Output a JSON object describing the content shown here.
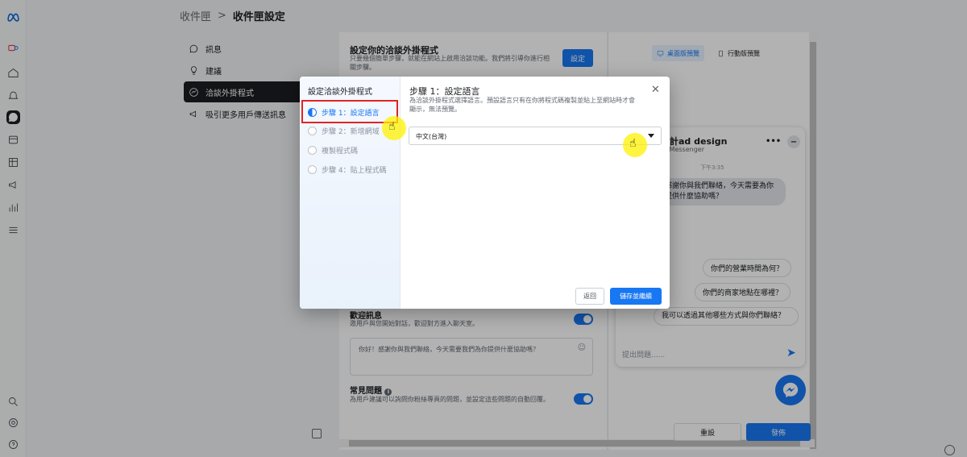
{
  "breadcrumb": {
    "parent": "收件匣",
    "separator": ">",
    "current": "收件匣設定"
  },
  "subnav": [
    {
      "label": "訊息",
      "icon": "chat-icon"
    },
    {
      "label": "建議",
      "icon": "lightbulb-icon"
    },
    {
      "label": "洽談外掛程式",
      "icon": "messenger-icon"
    },
    {
      "label": "吸引更多用戶傳送訊息",
      "icon": "megaphone-icon"
    }
  ],
  "main": {
    "heading": "設定你的洽談外掛程式",
    "description": "只要幾個簡單步驟，就能在網站上啟用洽談功能。我們將引導你進行相關步驟。",
    "set_label": "設定",
    "greeting_title": "歡迎訊息",
    "greeting_desc": "邀用戶與您開始對話，歡迎對方進入聊天室。",
    "greeting_text": "你好！感謝你與我們聯絡，今天需要我們為你提供什麼協助嗎？",
    "faq_title": "常見問題",
    "faq_desc": "為用戶建議可以詢問你粉絲專頁的問題，並設定這些問題的自動回覆。"
  },
  "preview": {
    "desktop_tab": "桌面版預覽",
    "mobile_tab": "行動版預覽",
    "chat_name": "設計ad design",
    "chat_via": "… Messenger",
    "time": "下午3:35",
    "incoming": "感謝你與我們聯絡，今天需要為你提供什麼協助嗎？",
    "quick_replies": [
      "你們的營業時間為何？",
      "你們的商家地點在哪裡？",
      "我可以透過其他哪些方式與你們聯絡？"
    ],
    "input_placeholder": "提出問題......",
    "reset_label": "重設",
    "publish_label": "發佈"
  },
  "modal": {
    "side_title": "設定洽談外掛程式",
    "steps": [
      {
        "label": "步驟 1：設定語言",
        "active": true
      },
      {
        "label": "步驟 2：新增網域",
        "active": false
      },
      {
        "label": "複製程式碼",
        "active": false
      },
      {
        "label": "步驟 4：貼上程式碼",
        "active": false
      }
    ],
    "title": "步驟 1：設定語言",
    "description": "為洽談外掛程式選擇語言。預設語言只有在你將程式碼複製並貼上至網站時才會顯示，無法預覽。",
    "language_value": "中文(台灣)",
    "back_label": "返回",
    "save_label": "儲存並繼續"
  },
  "colors": {
    "accent": "#1877f2",
    "highlight": "#e02424",
    "cursor": "#fff100"
  }
}
